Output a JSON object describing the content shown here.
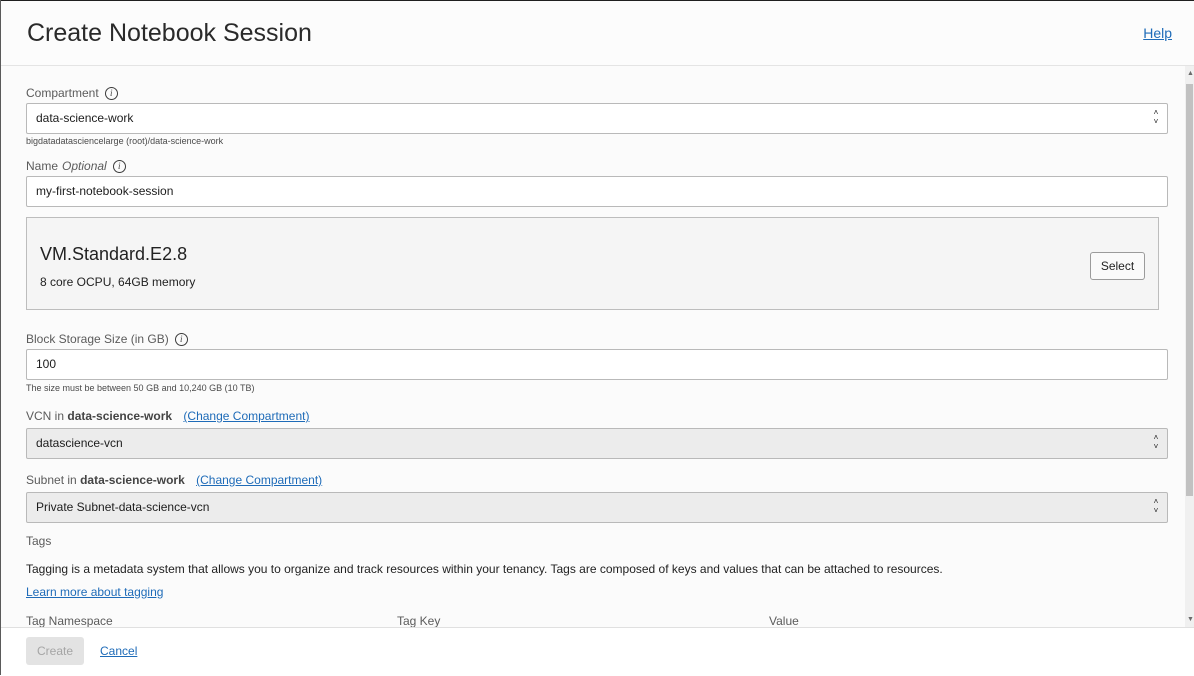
{
  "header": {
    "title": "Create Notebook Session",
    "help": "Help"
  },
  "compartment": {
    "label": "Compartment",
    "value": "data-science-work",
    "path": "bigdatadatasciencelarge (root)/data-science-work"
  },
  "name": {
    "label": "Name",
    "optional": "Optional",
    "value": "my-first-notebook-session"
  },
  "shape": {
    "name": "VM.Standard.E2.8",
    "description": "8 core OCPU, 64GB memory",
    "select_label": "Select"
  },
  "storage": {
    "label": "Block Storage Size (in GB)",
    "value": "100",
    "hint": "The size must be between 50 GB and 10,240 GB (10 TB)"
  },
  "vcn": {
    "label_prefix": "VCN in",
    "compartment": "data-science-work",
    "change_link": "(Change Compartment)",
    "value": "datascience-vcn"
  },
  "subnet": {
    "label_prefix": "Subnet in",
    "compartment": "data-science-work",
    "change_link": "(Change Compartment)",
    "value": "Private Subnet-data-science-vcn"
  },
  "tags": {
    "title": "Tags",
    "description": "Tagging is a metadata system that allows you to organize and track resources within your tenancy. Tags are composed of keys and values that can be attached to resources.",
    "learn_more": "Learn more about tagging",
    "columns": [
      "Tag Namespace",
      "Tag Key",
      "Value"
    ]
  },
  "footer": {
    "create": "Create",
    "cancel": "Cancel"
  },
  "icons": {
    "info": "info-icon",
    "select_arrows": "updown-chevron-icon"
  }
}
